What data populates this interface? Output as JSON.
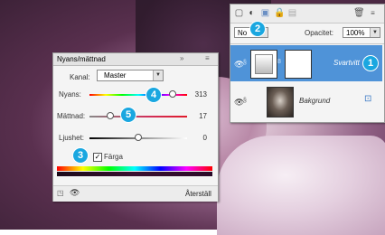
{
  "layers_panel": {
    "blend_mode": "Normal",
    "blend_mode_display": "No",
    "opacity_label": "Opacitet:",
    "opacity_value": "100%",
    "layers": [
      {
        "name": "Svartvitt",
        "selected": true
      },
      {
        "name": "Bakgrund",
        "selected": false
      }
    ]
  },
  "hue_sat_panel": {
    "title": "Nyans/mättnad",
    "channel_label": "Kanal:",
    "channel_value": "Master",
    "hue_label": "Nyans:",
    "hue_value": "313",
    "saturation_label": "Mättnad:",
    "saturation_value": "17",
    "lightness_label": "Ljushet:",
    "lightness_value": "0",
    "colorize_label": "Färga",
    "colorize_checked": true,
    "reset_label": "Återställ"
  },
  "badges": [
    "1",
    "2",
    "3",
    "4",
    "5"
  ],
  "colors": {
    "accent": "#1aa7e0",
    "selected_row": "#4f93d8"
  }
}
